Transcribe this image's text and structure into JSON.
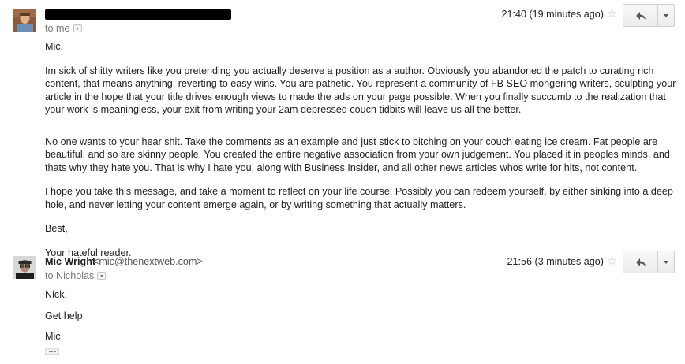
{
  "message1": {
    "recipient_label": "to me",
    "time": "21:40 (19 minutes ago)",
    "greeting": "Mic,",
    "paragraphs": [
      "Im sick of shitty writers like you pretending you actually deserve a position as a author. Obviously you abandoned the patch to curating rich content, that means anything, reverting to easy wins. You are pathetic. You represent a community of FB SEO mongering writers, sculpting your article in the hope that your title drives enough views to made the ads on your page possible. When you finally succumb to the realization that your work is meaningless, your exit from writing your 2am depressed couch tidbits will leave us all the better.",
      "No one wants to your hear shit. Take the comments as an example and just stick to bitching on your couch eating ice cream. Fat people are beautiful, and so are skinny people. You created the entire negative association from your own judgement. You placed it in peoples minds, and thats why they hate you. That is why I hate you, along with Business Insider, and all other news articles whos write for hits, not content.",
      "I hope you take this message, and take a moment to reflect on your life course. Possibly you can redeem yourself, by either sinking into a deep hole, and never letting your content emerge again, or by writing something that actually matters.",
      "Best,",
      "Your hateful reader."
    ]
  },
  "message2": {
    "sender_name": "Mic Wright",
    "sender_email": "<mic@thenextweb.com>",
    "recipient_label": "to Nicholas",
    "time": "21:56 (3 minutes ago)",
    "lines": [
      "Nick,",
      "Get help.",
      "Mic"
    ]
  },
  "icons": {
    "star": "star-outline-icon",
    "reply": "reply-arrow-icon",
    "more": "dropdown-caret-icon"
  }
}
